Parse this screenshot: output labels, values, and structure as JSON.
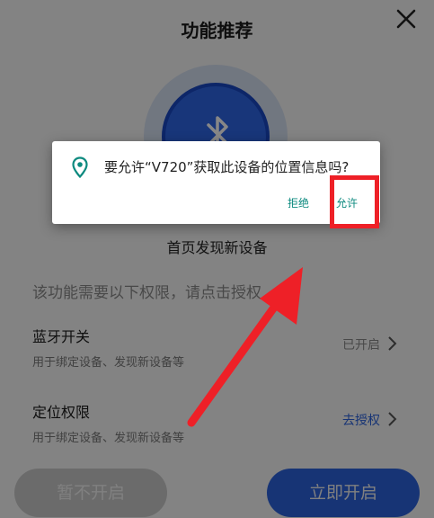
{
  "header": {
    "title": "功能推荐"
  },
  "feature": {
    "subtitle": "首页发现新设备",
    "description": "该功能需要以下权限，请点击授权"
  },
  "permissions": [
    {
      "name": "蓝牙开关",
      "sub": "用于绑定设备、发现新设备等",
      "status": "已开启",
      "status_color": "#8a8a8a"
    },
    {
      "name": "定位权限",
      "sub": "用于绑定设备、发现新设备等",
      "status": "去授权",
      "status_color": "#2d63de"
    }
  ],
  "buttons": {
    "skip": "暂不开启",
    "enable": "立即开启"
  },
  "dialog": {
    "message": "要允许“V720”获取此设备的位置信息吗?",
    "deny": "拒绝",
    "allow": "允许",
    "icon": "location-pin-icon"
  },
  "colors": {
    "accent": "#2d63de",
    "dialog_button": "#0d8a7f",
    "annotation": "#ee2027"
  }
}
